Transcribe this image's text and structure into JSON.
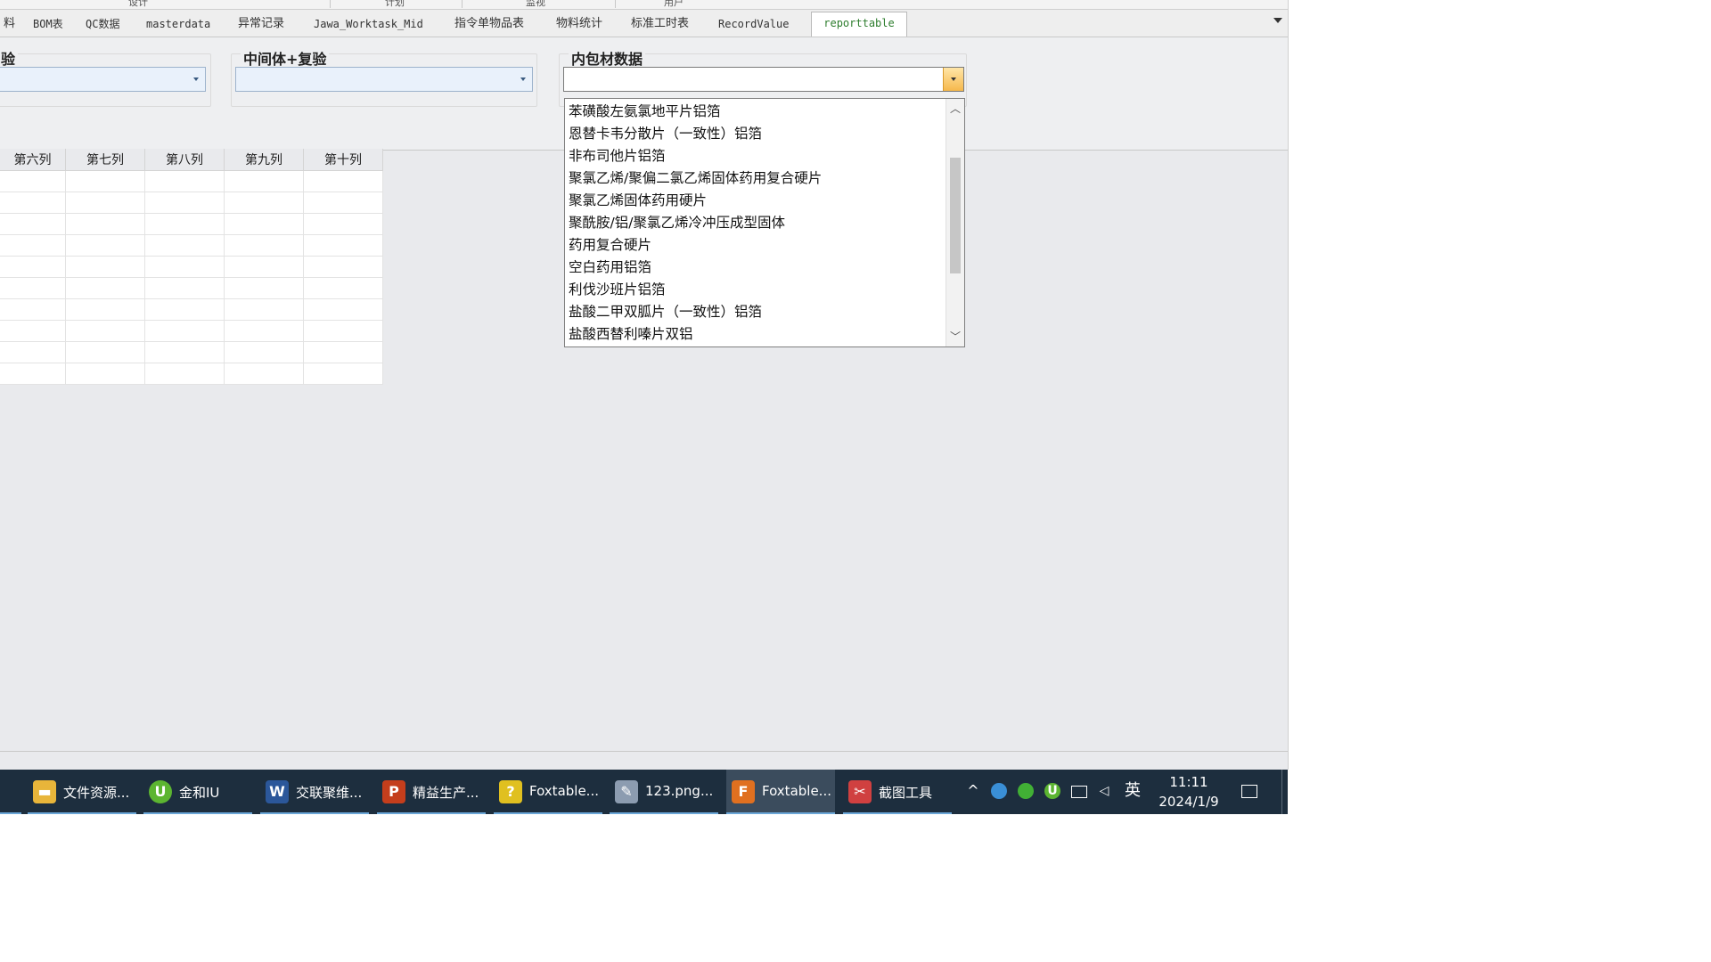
{
  "top_menu": [
    "设计",
    "计划",
    "监视",
    "用户"
  ],
  "tabs": [
    {
      "label": "料",
      "mono": false
    },
    {
      "label": "BOM表",
      "mono": true
    },
    {
      "label": "QC数据",
      "mono": true
    },
    {
      "label": "masterdata",
      "mono": true
    },
    {
      "label": "异常记录",
      "mono": false
    },
    {
      "label": "Jawa_Worktask_Mid",
      "mono": true
    },
    {
      "label": "指令单物品表",
      "mono": false
    },
    {
      "label": "物料统计",
      "mono": false
    },
    {
      "label": "标准工时表",
      "mono": false
    },
    {
      "label": "RecordValue",
      "mono": true
    },
    {
      "label": "reporttable",
      "mono": true,
      "active": true
    }
  ],
  "groups": {
    "g1_title": "验",
    "g1_value": "",
    "g2_title": "中间体+复验",
    "g2_value": "",
    "g3_title": "内包材数据",
    "g3_value": ""
  },
  "grid": {
    "columns": [
      "第六列",
      "第七列",
      "第八列",
      "第九列",
      "第十列"
    ],
    "row_count": 10
  },
  "dropdown": {
    "items": [
      "苯磺酸左氨氯地平片铝箔",
      "恩替卡韦分散片（一致性）铝箔",
      "非布司他片铝箔",
      "聚氯乙烯/聚偏二氯乙烯固体药用复合硬片",
      "聚氯乙烯固体药用硬片",
      "聚酰胺/铝/聚氯乙烯冷冲压成型固体",
      "药用复合硬片",
      "空白药用铝箔",
      "利伐沙班片铝箔",
      "盐酸二甲双胍片（一致性）铝箔",
      "盐酸西替利嗪片双铝"
    ],
    "scroll_position_fraction": 0.2
  },
  "taskbar": {
    "items": [
      {
        "label": "文件资源...",
        "icon": "folder-icon",
        "color": "#e8b53a",
        "glyph": "▬"
      },
      {
        "label": "金和IU",
        "icon": "jinhe-iu-icon",
        "color": "#5cb531",
        "glyph": "U"
      },
      {
        "label": "交联聚维...",
        "icon": "word-icon",
        "color": "#2b579a",
        "glyph": "W"
      },
      {
        "label": "精益生产...",
        "icon": "powerpoint-icon",
        "color": "#c43e1c",
        "glyph": "P"
      },
      {
        "label": "Foxtable...",
        "icon": "help-icon",
        "color": "#e0c020",
        "glyph": "?"
      },
      {
        "label": "123.png...",
        "icon": "paint-icon",
        "color": "#8c9cb0",
        "glyph": "✎"
      },
      {
        "label": "Foxtable...",
        "icon": "foxtable-icon",
        "color": "#e07020",
        "glyph": "F",
        "active": true
      },
      {
        "label": "截图工具",
        "icon": "snipping-tool-icon",
        "color": "#d04040",
        "glyph": "✂"
      }
    ],
    "ime": "英",
    "time": "11:11",
    "date": "2024/1/9"
  }
}
